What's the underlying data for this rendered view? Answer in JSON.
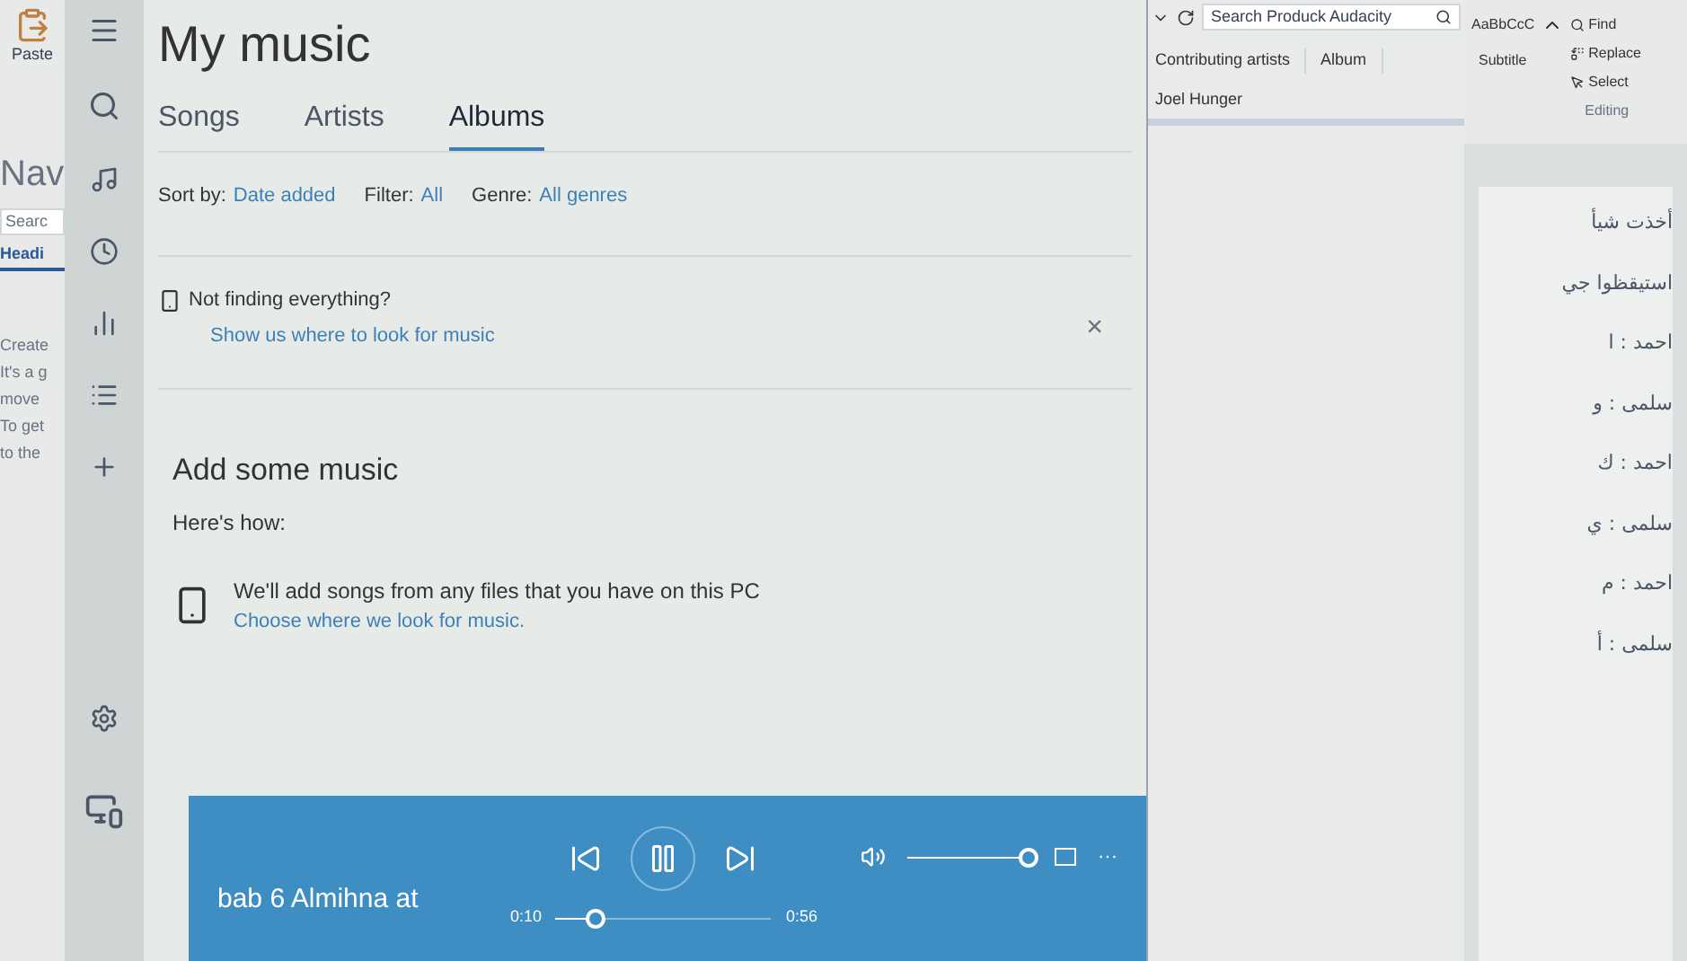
{
  "word_left": {
    "paste": "Paste",
    "nav_title": "Nav",
    "search": "Searc",
    "tab": "Headi",
    "lines": [
      "Create",
      "It's a g",
      "move",
      "To get",
      "to the"
    ]
  },
  "app": {
    "title": "My music",
    "tabs": [
      {
        "label": "Songs",
        "selected": false
      },
      {
        "label": "Artists",
        "selected": false
      },
      {
        "label": "Albums",
        "selected": true
      }
    ],
    "filters": [
      {
        "label": "Sort by:",
        "value": "Date added"
      },
      {
        "label": "Filter:",
        "value": "All"
      },
      {
        "label": "Genre:",
        "value": "All genres"
      }
    ],
    "notice": {
      "title": "Not finding everything?",
      "link": "Show us where to look for music",
      "close": "×"
    },
    "add": {
      "title": "Add some music",
      "subtitle": "Here's how:",
      "step": "We'll add songs from any files that you have on this PC",
      "link": "Choose where we look for music."
    },
    "player": {
      "track": "bab 6 Almihna at",
      "elapsed": "0:10",
      "duration": "0:56",
      "level": 0.18,
      "playing": true,
      "volume": {
        "level": 0.95
      },
      "more": "···"
    }
  },
  "explorer": {
    "search": {
      "placeholder": "Search Produck Audacity"
    },
    "columns": [
      "Contributing artists",
      "Album"
    ],
    "rows": [
      {
        "column_1": "Joel Hunger"
      }
    ]
  },
  "ribbon": {
    "style": "AaBbCcC",
    "style_name": "Subtitle",
    "find": "Find",
    "replace": "Replace",
    "select": "Select",
    "group": "Editing"
  },
  "document": {
    "lines": [
      "أخذت شيأ",
      "استيقظوا جي",
      "احمد : ا",
      "سلمى : و",
      "احمد : ك",
      "سلمى : ي",
      "احمد : م",
      "سلمى : أ"
    ]
  }
}
